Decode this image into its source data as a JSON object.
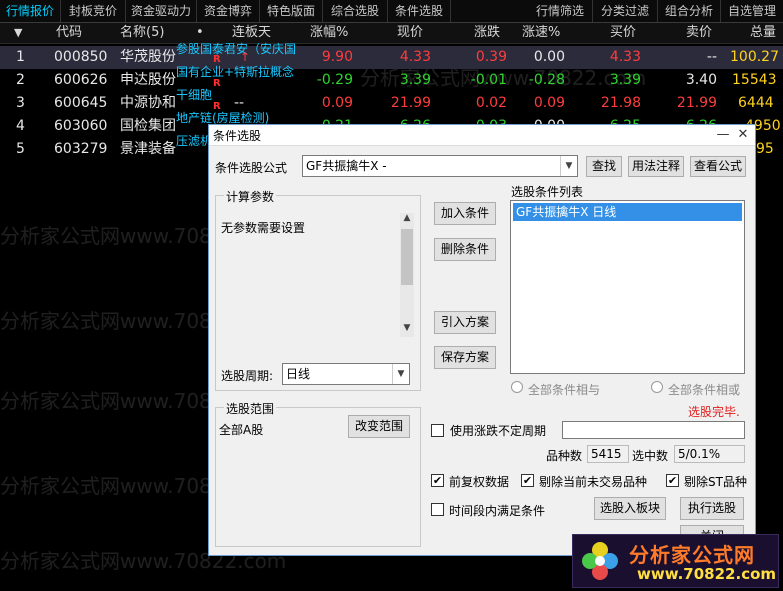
{
  "top_tabs": [
    "行情报价",
    "封板竞价",
    "资金驱动力",
    "资金博弈",
    "特色版面",
    "综合选股",
    "条件选股",
    "行情筛选",
    "分类过滤",
    "组合分析",
    "自选管理"
  ],
  "columns": {
    "sort": "▼",
    "code": "代码",
    "name": "名称(5)",
    "dot": "•",
    "days": "连板天",
    "pct": "涨幅%",
    "price": "现价",
    "chg": "涨跌",
    "speed": "涨速%",
    "bid": "买价",
    "ask": "卖价",
    "vol": "总量"
  },
  "rows": [
    {
      "idx": "1",
      "code": "000850",
      "name": "华茂股份",
      "concept": "参股国泰君安（安庆国",
      "days": "↑",
      "pct": "9.90",
      "price": "4.33",
      "chg": "0.39",
      "speed": "0.00",
      "bid": "4.33",
      "ask": "--",
      "vol": "100.27"
    },
    {
      "idx": "2",
      "code": "600626",
      "name": "申达股份",
      "concept": "国有企业+特斯拉概念",
      "days": "",
      "pct": "-0.29",
      "price": "3.39",
      "chg": "-0.01",
      "speed": "-0.28",
      "bid": "3.39",
      "ask": "3.40",
      "vol": "15543"
    },
    {
      "idx": "3",
      "code": "600645",
      "name": "中源协和",
      "concept": "干细胞",
      "days": "--",
      "pct": "0.09",
      "price": "21.99",
      "chg": "0.02",
      "speed": "0.09",
      "bid": "21.98",
      "ask": "21.99",
      "vol": "6444"
    },
    {
      "idx": "4",
      "code": "603060",
      "name": "国检集团",
      "concept": "地产链(房屋检测)",
      "days": "",
      "pct": "0.21",
      "price": "6.26",
      "chg": "0.03",
      "speed": "0.00",
      "bid": "6.25",
      "ask": "6.26",
      "vol": "4950"
    },
    {
      "idx": "5",
      "code": "603279",
      "name": "景津装备",
      "concept": "压滤机",
      "days": "",
      "pct": "",
      "price": "",
      "chg": "",
      "speed": "",
      "bid": "",
      "ask": "",
      "vol": "95"
    }
  ],
  "watermark": "分析家公式网www.70822.com",
  "dialog": {
    "title": "条件选股",
    "formula_label": "条件选股公式",
    "formula_value": "GF共振擒牛X  -",
    "btn_find": "查找",
    "btn_usage": "用法注释",
    "btn_view": "查看公式",
    "params_group": "计算参数",
    "params_text": "无参数需要设置",
    "period_label": "选股周期:",
    "period_value": "日线",
    "btn_add": "加入条件",
    "btn_delete": "删除条件",
    "btn_import": "引入方案",
    "btn_save": "保存方案",
    "list_label": "选股条件列表",
    "list_items": [
      "GF共振擒牛X  日线"
    ],
    "radio_and": "全部条件相与",
    "radio_or": "全部条件相或",
    "status": "选股完毕.",
    "range_group": "选股范围",
    "range_value": "全部A股",
    "btn_change_range": "改变范围",
    "use_period_label": "使用涨跌不定周期",
    "count_label": "品种数",
    "count_value": "5415",
    "selected_label": "选中数",
    "selected_value": "5/0.1%",
    "chk_restore": "前复权数据",
    "chk_exclude_untraded": "剔除当前未交易品种",
    "chk_exclude_st": "剔除ST品种",
    "chk_period_satisfy": "时间段内满足条件",
    "btn_to_board": "选股入板块",
    "btn_execute": "执行选股",
    "btn_close": "关闭"
  },
  "logo": {
    "name": "分析家公式网",
    "url": "www.70822.com"
  }
}
